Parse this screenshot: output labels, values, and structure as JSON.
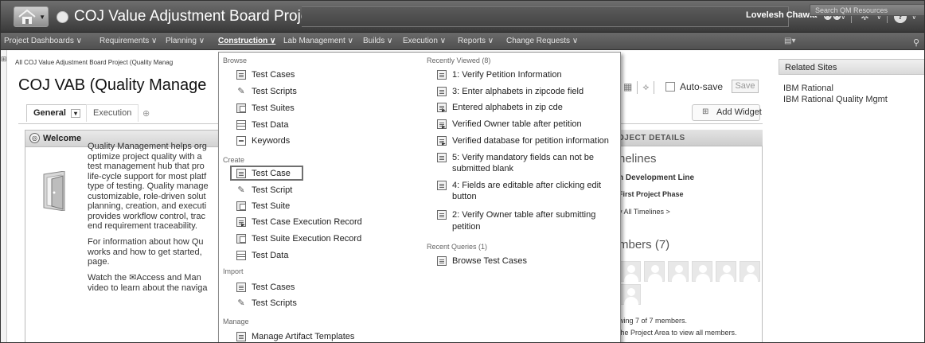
{
  "titlebar": {
    "home_icon": "home-icon",
    "app_title": "COJ Value Adjustment Board Project (Quality Management)",
    "user_name": "Lovelesh Chawla",
    "icons": [
      "users-icon",
      "gear-icon",
      "help-icon"
    ]
  },
  "menubar": {
    "items": [
      "Project Dashboards ∨",
      "Requirements ∨",
      "Planning ∨",
      "Construction ∨",
      "Lab Management ∨",
      "Builds ∨",
      "Execution ∨",
      "Reports ∨",
      "Change Requests ∨"
    ],
    "active": "Construction ∨",
    "search_placeholder": "Search QM Resources"
  },
  "breadcrumb": "All COJ Value Adjustment Board Project (Quality Manag",
  "page_title": "COJ VAB (Quality Manage",
  "tabs": [
    {
      "label": "General",
      "selected": true
    },
    {
      "label": "Execution",
      "selected": false
    }
  ],
  "toolbar": {
    "autosave_label": "Auto-save",
    "save_label": "Save",
    "add_widget_label": "Add Widget"
  },
  "welcome": {
    "title": "Welcome",
    "lines": [
      "Quality Management helps org",
      "optimize project quality with a",
      "test management hub that pro",
      "life-cycle support for most platf",
      "type of testing. Quality manage",
      "customizable, role-driven solut",
      "planning, creation, and executi",
      "provides workflow control, trac",
      "end requirement traceability.",
      "",
      "For information about how Qu",
      "works and how to get started,",
      "page.",
      "",
      "Watch the ✉Access and Man",
      "video to learn about the naviga"
    ]
  },
  "project_details": {
    "header": "OJECT DETAILS",
    "timelines_title": "nelines",
    "dev_line": "n Development Line",
    "phase": "First Project Phase",
    "view_all": "v All Timelines >",
    "members_title": "mbers (7)",
    "showing": "wing 7 of 7 members.",
    "project_area_note": "the Project Area to view all members."
  },
  "related_sites": {
    "title": "Related Sites",
    "items": [
      "IBM Rational",
      "IBM Rational Quality Mgmt"
    ]
  },
  "dropdown": {
    "browse": {
      "label": "Browse",
      "items": [
        {
          "label": "Test Cases",
          "icon": "test-case-icon"
        },
        {
          "label": "Test Scripts",
          "icon": "test-script-icon"
        },
        {
          "label": "Test Suites",
          "icon": "test-suite-icon"
        },
        {
          "label": "Test Data",
          "icon": "test-data-icon"
        },
        {
          "label": "Keywords",
          "icon": "keyword-icon"
        }
      ]
    },
    "create": {
      "label": "Create",
      "items": [
        {
          "label": "Test Case",
          "icon": "test-case-icon"
        },
        {
          "label": "Test Script",
          "icon": "test-script-icon"
        },
        {
          "label": "Test Suite",
          "icon": "test-suite-icon"
        },
        {
          "label": "Test Case Execution Record",
          "icon": "execution-record-icon"
        },
        {
          "label": "Test Suite Execution Record",
          "icon": "suite-execution-record-icon"
        },
        {
          "label": "Test Data",
          "icon": "test-data-icon"
        }
      ]
    },
    "import": {
      "label": "Import",
      "items": [
        {
          "label": "Test Cases",
          "icon": "test-case-icon"
        },
        {
          "label": "Test Scripts",
          "icon": "test-script-icon"
        }
      ]
    },
    "manage": {
      "label": "Manage",
      "items": [
        {
          "label": "Manage Artifact Templates",
          "icon": "template-icon"
        }
      ]
    },
    "recently_viewed": {
      "label": "Recently Viewed (8)",
      "items": [
        "1: Verify Petition Information",
        "3: Enter alphabets in zipcode field",
        "Entered alphabets in zip cde",
        "Verified Owner table after petition",
        "Verified database for petition information",
        "5: Verify mandatory fields can not be",
        "submitted blank",
        "4: Fields are editable after clicking edit",
        "button",
        "2: Verify Owner table after submitting",
        "petition"
      ]
    },
    "recent_queries": {
      "label": "Recent Queries (1)",
      "items": [
        "Browse Test Cases"
      ]
    }
  }
}
